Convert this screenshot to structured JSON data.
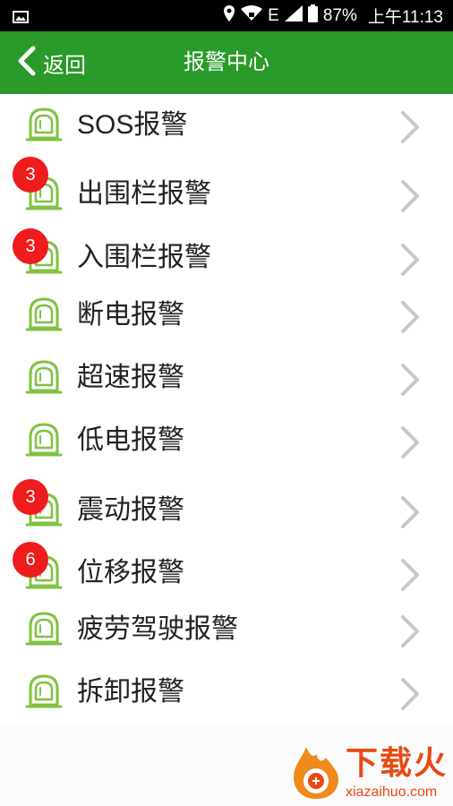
{
  "status_bar": {
    "battery_percent": "87%",
    "time": "上午11:13",
    "network": "E",
    "icons": [
      "gallery-icon",
      "location-icon",
      "wifi-icon",
      "signal-icon",
      "battery-icon"
    ]
  },
  "header": {
    "back_label": "返回",
    "title": "报警中心",
    "background": "#2a9a2a"
  },
  "alarm_list": {
    "items": [
      {
        "label": "SOS报警",
        "badge": ""
      },
      {
        "label": "出围栏报警",
        "badge": "3"
      },
      {
        "label": "入围栏报警",
        "badge": "3"
      },
      {
        "label": "断电报警",
        "badge": ""
      },
      {
        "label": "超速报警",
        "badge": ""
      },
      {
        "label": "低电报警",
        "badge": ""
      },
      {
        "label": "震动报警",
        "badge": "3"
      },
      {
        "label": "位移报警",
        "badge": "6"
      },
      {
        "label": "疲劳驾驶报警",
        "badge": ""
      },
      {
        "label": "拆卸报警",
        "badge": ""
      }
    ],
    "icon": "alarm-bell-icon",
    "icon_color": "#7fc241",
    "badge_color": "#ee1c1c"
  },
  "watermark": {
    "title": "下载火",
    "domain": "xiazaihuo.com"
  }
}
